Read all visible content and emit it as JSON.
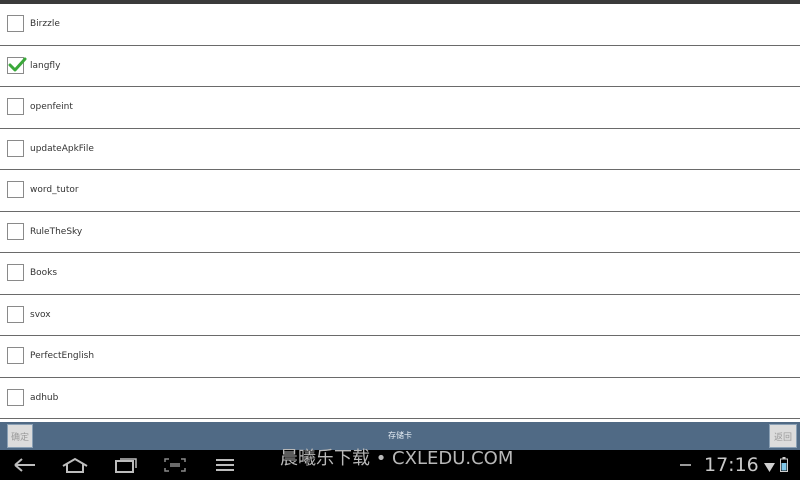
{
  "list": {
    "items": [
      {
        "label": "Birzzle",
        "checked": false
      },
      {
        "label": "langfly",
        "checked": true
      },
      {
        "label": "openfeint",
        "checked": false
      },
      {
        "label": "updateApkFile",
        "checked": false
      },
      {
        "label": "word_tutor",
        "checked": false
      },
      {
        "label": "RuleTheSky",
        "checked": false
      },
      {
        "label": "Books",
        "checked": false
      },
      {
        "label": "svox",
        "checked": false
      },
      {
        "label": "PerfectEnglish",
        "checked": false
      },
      {
        "label": "adhub",
        "checked": false
      }
    ]
  },
  "action_bar": {
    "ok_label": "确定",
    "title": "存储卡",
    "back_label": "返回"
  },
  "system_bar": {
    "watermark": "晨曦乐下载 • CXLEDU.COM",
    "time": "17:16"
  },
  "colors": {
    "check_green": "#3aa83a",
    "action_bar_bg": "#506a85"
  }
}
